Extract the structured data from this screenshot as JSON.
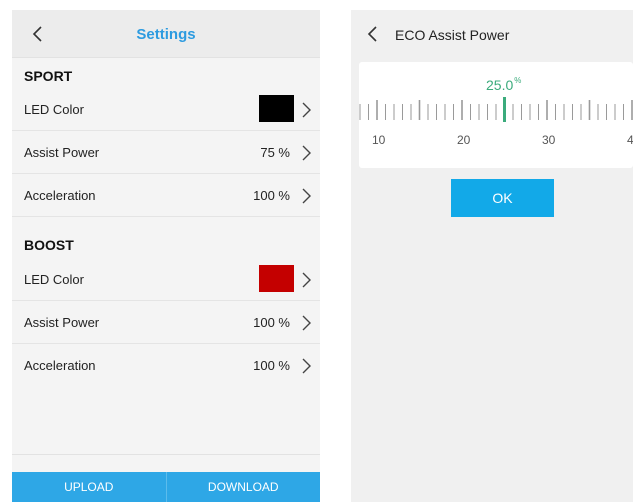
{
  "settings": {
    "title": "Settings",
    "sport": {
      "header": "SPORT",
      "led_label": "LED Color",
      "led_color": "#000000",
      "assist_label": "Assist Power",
      "assist_value": "75 %",
      "accel_label": "Acceleration",
      "accel_value": "100 %"
    },
    "boost": {
      "header": "BOOST",
      "led_label": "LED Color",
      "led_color": "#c40000",
      "assist_label": "Assist Power",
      "assist_value": "100 %",
      "accel_label": "Acceleration",
      "accel_value": "100 %"
    },
    "footer": {
      "upload_label": "UPLOAD",
      "download_label": "DOWNLOAD"
    },
    "accent_color": "#2d9be0",
    "bottom_bar_color": "#2ea7e6"
  },
  "eco": {
    "title": "ECO Assist Power",
    "value": "25.0",
    "unit": "%",
    "selected_value": 25.0,
    "scale_labels": [
      "10",
      "20",
      "30",
      "4"
    ],
    "ok_label": "OK",
    "indicator_color": "#3bab7c",
    "ok_color": "#12a9e8"
  },
  "icons": {
    "back": "chevron-left-icon",
    "row_arrow": "chevron-right-icon"
  }
}
